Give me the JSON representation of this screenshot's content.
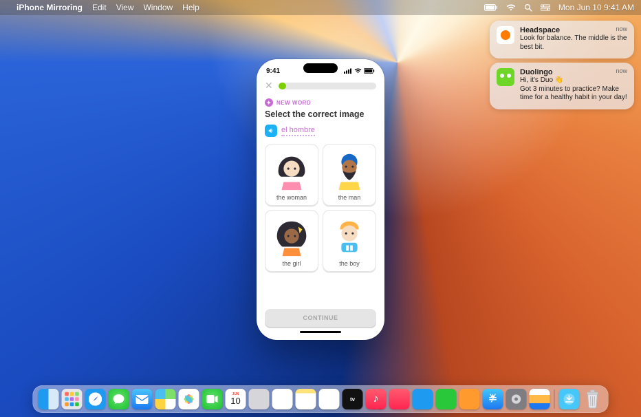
{
  "menubar": {
    "app_name": "iPhone Mirroring",
    "menus": [
      "Edit",
      "View",
      "Window",
      "Help"
    ],
    "clock": "Mon Jun 10  9:41 AM"
  },
  "notifications": [
    {
      "app": "Headspace",
      "body": "Look for balance. The middle is the best bit.",
      "time": "now",
      "icon": "headspace"
    },
    {
      "app": "Duolingo",
      "body_line1": "Hi, it's Duo 👋",
      "body_line2": "Got 3 minutes to practice? Make time for a healthy habit in your day!",
      "time": "now",
      "icon": "duolingo"
    }
  ],
  "iphone": {
    "status_time": "9:41",
    "progress_percent": 8,
    "newword_label": "NEW WORD",
    "instruction": "Select the correct image",
    "target_word": "el hombre",
    "choices": [
      {
        "label": "the woman"
      },
      {
        "label": "the man"
      },
      {
        "label": "the girl"
      },
      {
        "label": "the boy"
      }
    ],
    "continue_label": "CONTINUE"
  },
  "dock": {
    "apps": [
      {
        "name": "Finder",
        "cls": "i-finder"
      },
      {
        "name": "Launchpad",
        "cls": "i-launch"
      },
      {
        "name": "Safari",
        "cls": "i-safari"
      },
      {
        "name": "Messages",
        "cls": "i-msg"
      },
      {
        "name": "Mail",
        "cls": "i-mail"
      },
      {
        "name": "Maps",
        "cls": "i-maps"
      },
      {
        "name": "Photos",
        "cls": "i-photos"
      },
      {
        "name": "FaceTime",
        "cls": "i-ft"
      },
      {
        "name": "Calendar",
        "cls": "i-cal"
      },
      {
        "name": "Contacts",
        "cls": "i-contacts"
      },
      {
        "name": "Reminders",
        "cls": "i-rem"
      },
      {
        "name": "Notes",
        "cls": "i-notes"
      },
      {
        "name": "Freeform",
        "cls": "i-free"
      },
      {
        "name": "TV",
        "cls": "i-tv"
      },
      {
        "name": "Music",
        "cls": "i-music"
      },
      {
        "name": "News",
        "cls": "i-news"
      },
      {
        "name": "Keynote",
        "cls": "i-key"
      },
      {
        "name": "Numbers",
        "cls": "i-num"
      },
      {
        "name": "Pages",
        "cls": "i-pages"
      },
      {
        "name": "App Store",
        "cls": "i-store"
      },
      {
        "name": "System Settings",
        "cls": "i-set"
      },
      {
        "name": "iPhone Mirroring",
        "cls": "i-mirror"
      }
    ],
    "right": [
      {
        "name": "Downloads",
        "cls": "i-dl"
      },
      {
        "name": "Trash",
        "cls": "dtrash"
      }
    ],
    "cal_month": "JUN",
    "cal_day": "10"
  }
}
